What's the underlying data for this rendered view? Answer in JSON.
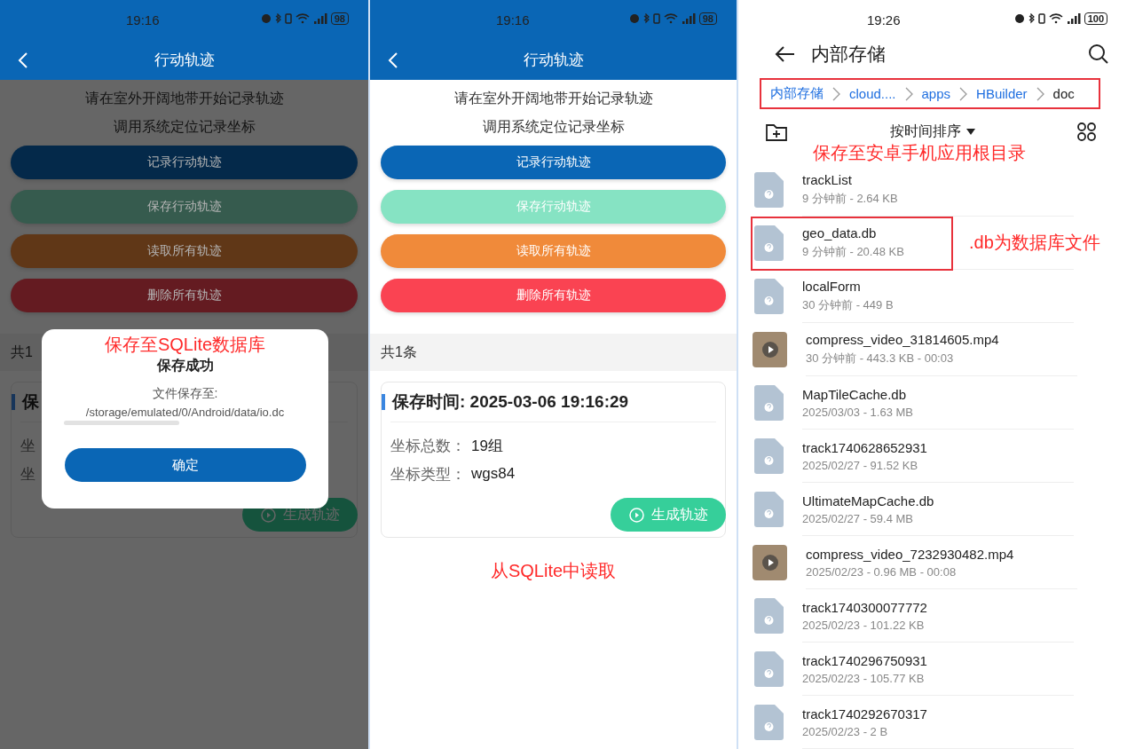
{
  "left_phone": {
    "status_bar": {
      "time": "19:16",
      "battery": "98"
    },
    "title": "行动轨迹",
    "hints": [
      "请在室外开阔地带开始记录轨迹",
      "调用系统定位记录坐标"
    ],
    "buttons": [
      {
        "label": "记录行动轨迹",
        "color": "#04294a"
      },
      {
        "label": "保存行动轨迹",
        "color": "#365b4e"
      },
      {
        "label": "读取所有轨迹",
        "color": "#603717"
      },
      {
        "label": "删除所有轨迹",
        "color": "#641b21"
      }
    ],
    "count": "共1",
    "card": {
      "title": "保",
      "rows": [
        {
          "label": "坐"
        },
        {
          "label": "坐"
        }
      ],
      "action": "生成轨迹"
    },
    "dialog": {
      "annotation": "保存至SQLite数据库",
      "title": "保存成功",
      "label": "文件保存至:",
      "path": "/storage/emulated/0/Android/data/io.dc",
      "button": "确定"
    }
  },
  "middle_phone": {
    "status_bar": {
      "time": "19:16",
      "battery": "98"
    },
    "title": "行动轨迹",
    "hints": [
      "请在室外开阔地带开始记录轨迹",
      "调用系统定位记录坐标"
    ],
    "buttons": [
      {
        "label": "记录行动轨迹",
        "color": "#0a66b5"
      },
      {
        "label": "保存行动轨迹",
        "color": "#86e3c3"
      },
      {
        "label": "读取所有轨迹",
        "color": "#f08a3a"
      },
      {
        "label": "删除所有轨迹",
        "color": "#fa4352"
      }
    ],
    "count": "共1条",
    "card": {
      "title": "保存时间: 2025-03-06 19:16:29",
      "rows": [
        {
          "label": "坐标总数：",
          "value": "19组"
        },
        {
          "label": "坐标类型：",
          "value": "wgs84"
        }
      ],
      "action": "生成轨迹"
    },
    "annotation": "从SQLite中读取"
  },
  "right_phone": {
    "status_bar": {
      "time": "19:26",
      "battery": "100"
    },
    "title": "内部存储",
    "breadcrumbs": {
      "boxed": true,
      "items": [
        {
          "label": "内部存储",
          "current": false
        },
        {
          "label": "cloud....",
          "current": false
        },
        {
          "label": "apps",
          "current": false
        },
        {
          "label": "HBuilder",
          "current": false
        },
        {
          "label": "doc",
          "current": true
        }
      ]
    },
    "sort": "按时间排序",
    "annotation": "保存至安卓手机应用根目录",
    "files": [
      {
        "name": "trackList",
        "meta": "9 分钟前 - 2.64 KB",
        "kind": "file"
      },
      {
        "name": "geo_data.db",
        "meta": "9 分钟前 - 20.48 KB",
        "kind": "file",
        "boxed": true,
        "annotation": ".db为数据库文件"
      },
      {
        "name": "localForm",
        "meta": "30 分钟前 - 449 B",
        "kind": "file"
      },
      {
        "name": "compress_video_31814605.mp4",
        "meta": "30 分钟前 - 443.3 KB - 00:03",
        "kind": "video"
      },
      {
        "name": "MapTileCache.db",
        "meta": "2025/03/03 - 1.63 MB",
        "kind": "file"
      },
      {
        "name": "track1740628652931",
        "meta": "2025/02/27 - 91.52 KB",
        "kind": "file"
      },
      {
        "name": "UltimateMapCache.db",
        "meta": "2025/02/27 - 59.4 MB",
        "kind": "file"
      },
      {
        "name": "compress_video_7232930482.mp4",
        "meta": "2025/02/23 - 0.96 MB - 00:08",
        "kind": "video"
      },
      {
        "name": "track1740300077772",
        "meta": "2025/02/23 - 101.22 KB",
        "kind": "file"
      },
      {
        "name": "track1740296750931",
        "meta": "2025/02/23 - 105.77 KB",
        "kind": "file"
      },
      {
        "name": "track1740292670317",
        "meta": "2025/02/23 - 2 B",
        "kind": "file"
      }
    ]
  }
}
